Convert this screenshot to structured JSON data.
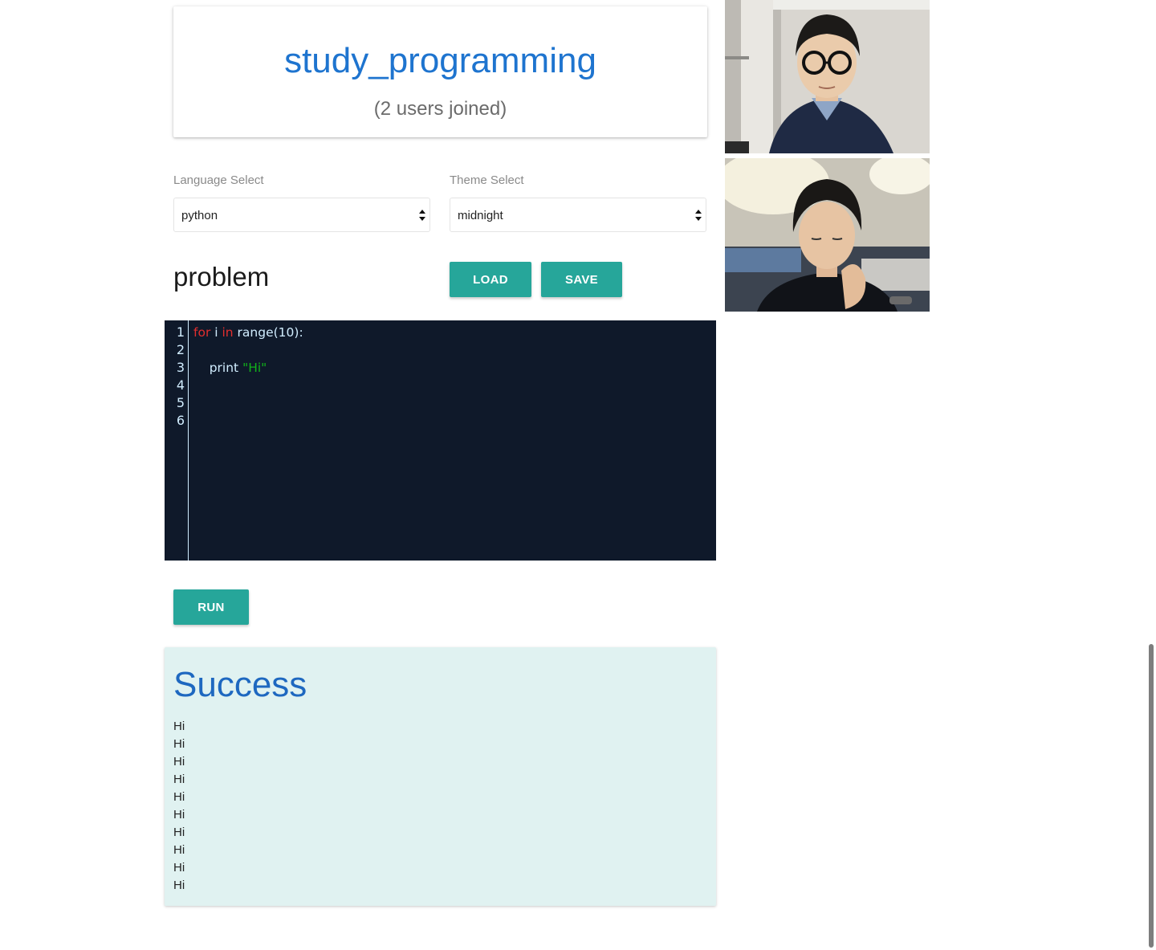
{
  "room": {
    "title": "study_programming",
    "subtitle": "(2 users joined)"
  },
  "language_select": {
    "label": "Language Select",
    "value": "python"
  },
  "theme_select": {
    "label": "Theme Select",
    "value": "midnight"
  },
  "problem": {
    "title": "problem",
    "load_label": "LOAD",
    "save_label": "SAVE"
  },
  "editor": {
    "line_numbers": [
      "1",
      "2",
      "3",
      "4",
      "5",
      "6"
    ],
    "line1": {
      "kw1": "for",
      "var": " i ",
      "kw2": "in",
      "rest": " range(10):"
    },
    "line3": {
      "call": "    print ",
      "str": "\"Hi\""
    }
  },
  "run_label": "RUN",
  "output": {
    "title": "Success",
    "lines": [
      "Hi",
      "Hi",
      "Hi",
      "Hi",
      "Hi",
      "Hi",
      "Hi",
      "Hi",
      "Hi",
      "Hi"
    ]
  },
  "colors": {
    "accent": "#26a69a",
    "title_blue": "#1e74cf",
    "editor_bg": "#0f192a",
    "output_bg": "#e0f2f1"
  }
}
